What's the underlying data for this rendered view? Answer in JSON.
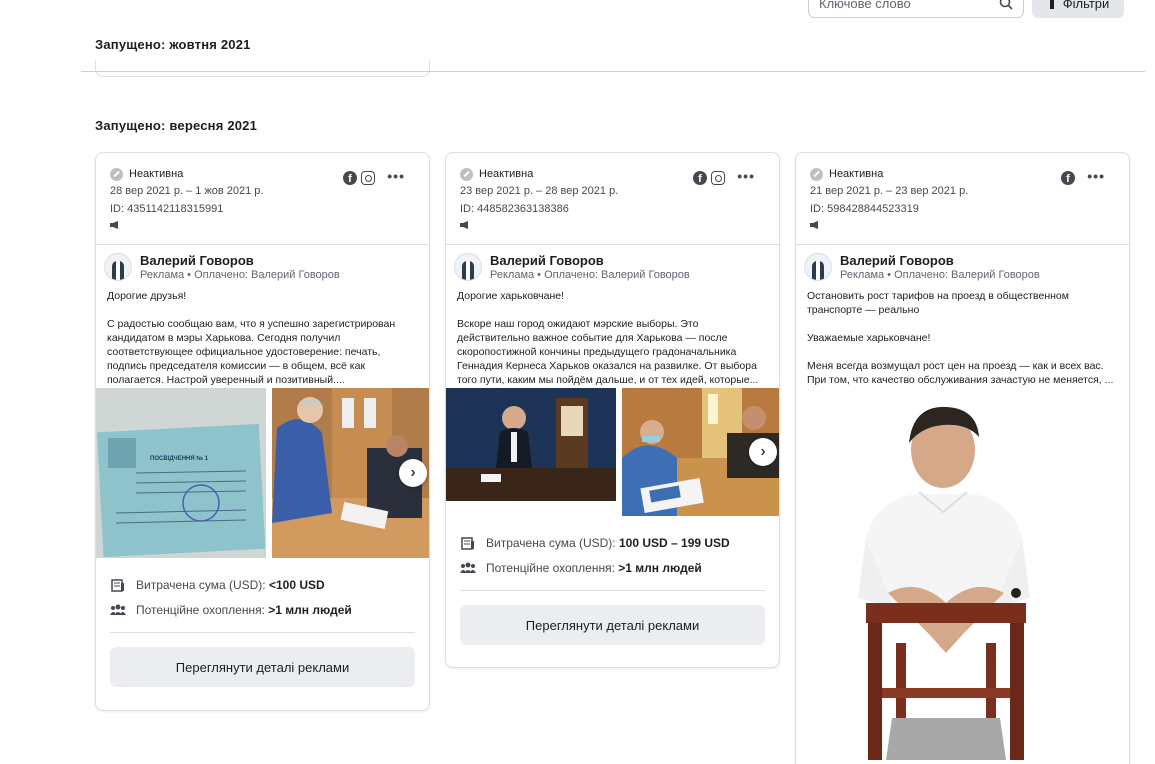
{
  "toolbar": {
    "search_placeholder": "Ключове слово",
    "filters_label": "Фільтри"
  },
  "sections": [
    {
      "title": "Запущено: жовтня 2021"
    },
    {
      "title": "Запущено: вересня 2021"
    }
  ],
  "cards": [
    {
      "status": "Неактивна",
      "dates": "28 вер 2021 р. – 1 жов 2021 р.",
      "id": "ID: 4351142118315991",
      "platforms": [
        "facebook",
        "instagram"
      ],
      "advertiser": "Валерий Говоров",
      "sponsor_line": "Реклама • Оплачено: Валерий Говоров",
      "text": [
        "Дорогие друзья!",
        "С радостью сообщаю вам, что я успешно зарегистрирован кандидатом в мэры Харькова. Сегодня получил соответствующее официальное удостоверение: печать, подпись председателя комиссии — в общем, всё как полагается. Настрой уверенный и позитивный...."
      ],
      "images": [
        {
          "name": "certificate-photo",
          "heading": "ПОСВІДЧЕННЯ № 1"
        },
        {
          "name": "registration-photo"
        }
      ],
      "spend_label": "Витрачена сума (USD):",
      "spend_value": "<100 USD",
      "reach_label": "Потенційне охоплення:",
      "reach_value": ">1 млн людей",
      "details_label": "Переглянути деталі реклами"
    },
    {
      "status": "Неактивна",
      "dates": "23 вер 2021 р. – 28 вер 2021 р.",
      "id": "ID: 448582363138386",
      "platforms": [
        "facebook",
        "instagram"
      ],
      "advertiser": "Валерий Говоров",
      "sponsor_line": "Реклама • Оплачено: Валерий Говоров",
      "text": [
        "Дорогие харьковчане!",
        "Вскоре наш город ожидают мэрские выборы. Это действительно важное событие для Харькова — после скоропостижной кончины предыдущего градоначальника Геннадия Кернеса Харьков оказался на развилке. От выбора того пути, каким мы пойдём дальше, и от тех идей, которые..."
      ],
      "images": [
        {
          "name": "office-desk-photo"
        },
        {
          "name": "meeting-photo"
        }
      ],
      "spend_label": "Витрачена сума (USD):",
      "spend_value": "100 USD – 199 USD",
      "reach_label": "Потенційне охоплення:",
      "reach_value": ">1 млн людей",
      "details_label": "Переглянути деталі реклами"
    },
    {
      "status": "Неактивна",
      "dates": "21 вер 2021 р. – 23 вер 2021 р.",
      "id": "ID: 598428844523319",
      "platforms": [
        "facebook"
      ],
      "advertiser": "Валерий Говоров",
      "sponsor_line": "Реклама • Оплачено: Валерий Говоров",
      "text": [
        "Остановить рост тарифов на проезд в общественном транспорте — реально",
        "Уважаемые харьковчане!",
        "Меня всегда возмущал рост цен на проезд — как и всех вас. При том, что качество обслуживания зачастую не меняется, ..."
      ],
      "images": [
        {
          "name": "portrait-photo"
        }
      ]
    }
  ]
}
